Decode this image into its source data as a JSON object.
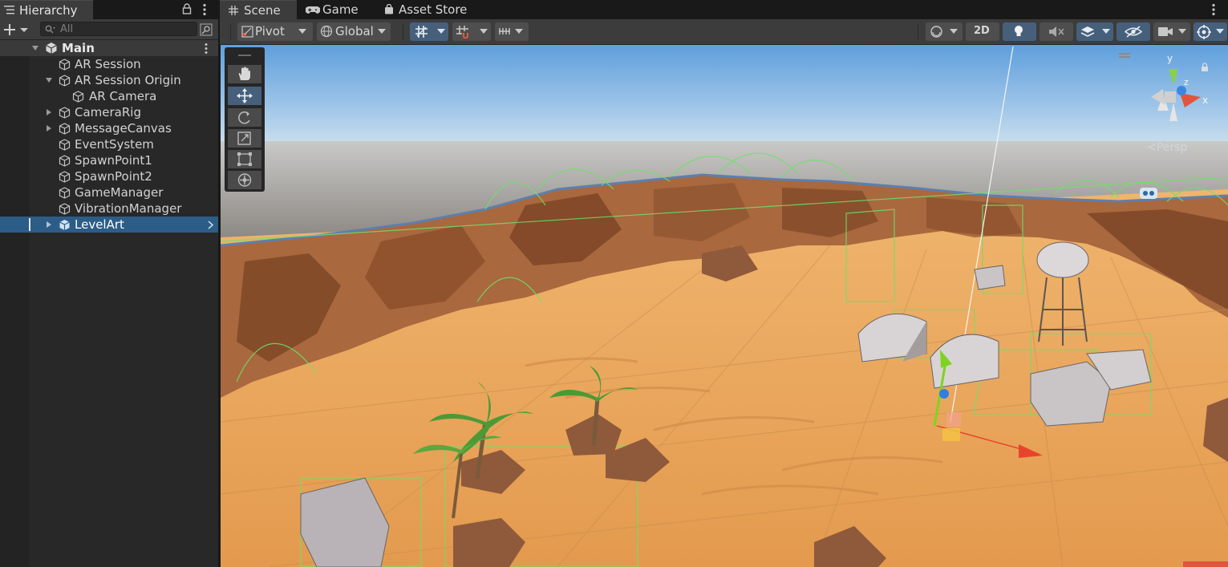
{
  "hierarchy": {
    "tab_label": "Hierarchy",
    "search_placeholder": "All",
    "scene_name": "Main",
    "items": [
      {
        "label": "AR Session"
      },
      {
        "label": "AR Session Origin"
      },
      {
        "label": "AR Camera"
      },
      {
        "label": "CameraRig"
      },
      {
        "label": "MessageCanvas"
      },
      {
        "label": "EventSystem"
      },
      {
        "label": "SpawnPoint1"
      },
      {
        "label": "SpawnPoint2"
      },
      {
        "label": "GameManager"
      },
      {
        "label": "VibrationManager"
      },
      {
        "label": "LevelArt"
      }
    ],
    "selected_item": "LevelArt"
  },
  "scene_tabs": [
    {
      "label": "Scene",
      "icon": "hash-icon"
    },
    {
      "label": "Game",
      "icon": "gamepad-icon"
    },
    {
      "label": "Asset Store",
      "icon": "bag-icon"
    }
  ],
  "scene_toolbar": {
    "pivot_label": "Pivot",
    "global_label": "Global",
    "two_d_label": "2D"
  },
  "viewport": {
    "persp_label": "<Persp",
    "gizmo_axes": {
      "y": "y",
      "z": "z",
      "x": "x"
    }
  },
  "colors": {
    "selection": "#2c5d87",
    "active_tool": "#46607c",
    "sand": "#e7a55a",
    "sky_top": "#62a0dc"
  }
}
